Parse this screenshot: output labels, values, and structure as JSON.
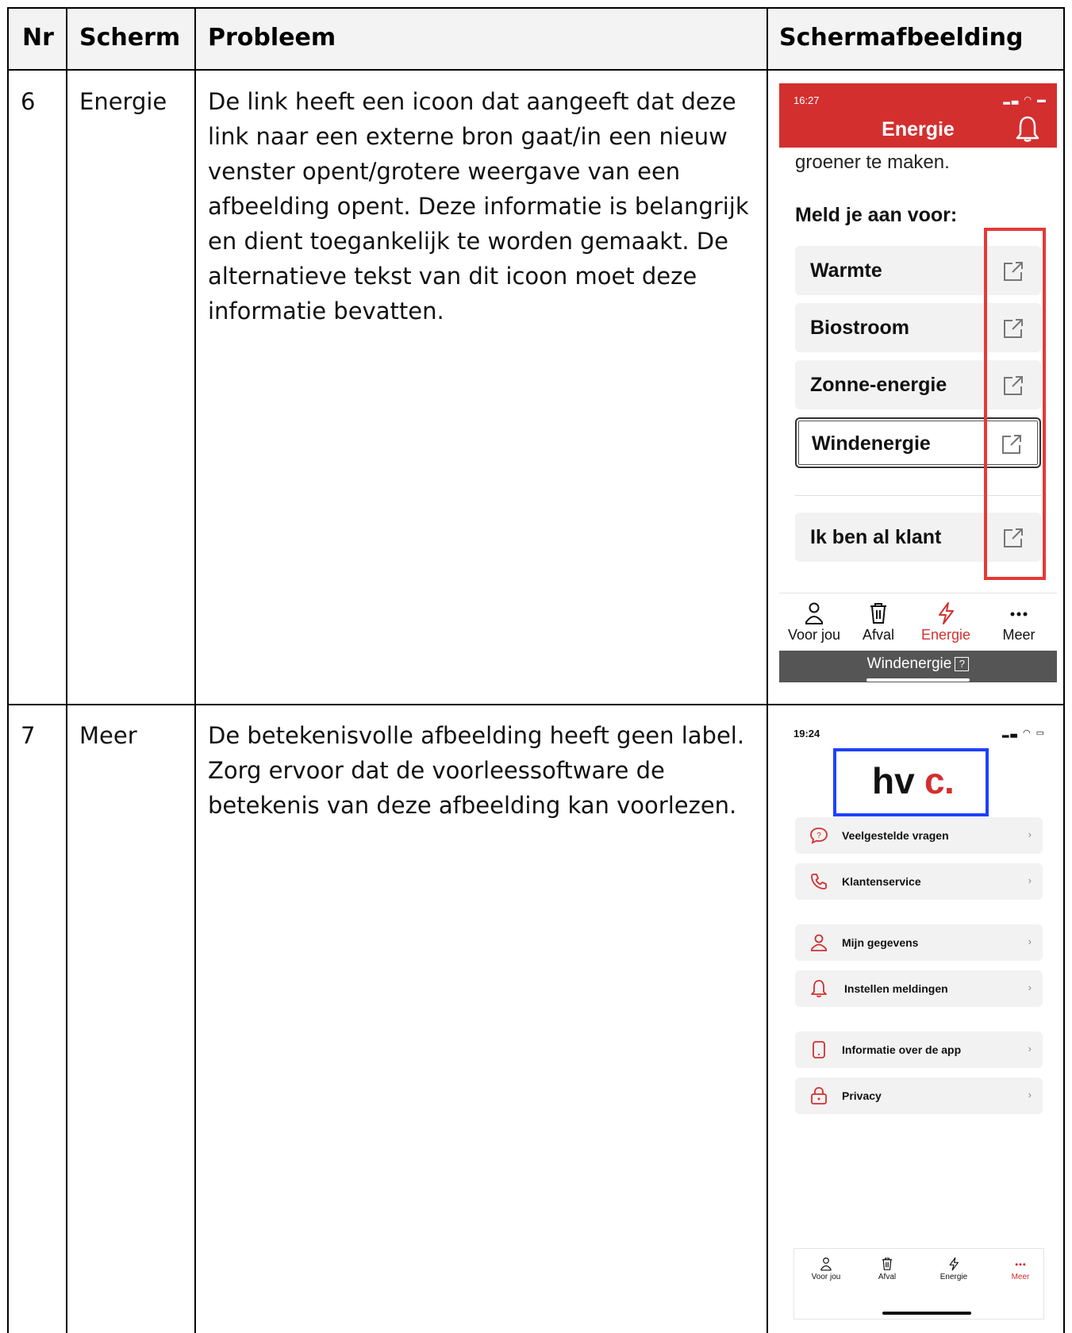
{
  "table": {
    "headers": {
      "nr": "Nr",
      "scherm": "Scherm",
      "probleem": "Probleem",
      "screenshot": "Schermafbeelding"
    },
    "rows": [
      {
        "nr": "6",
        "scherm": "Energie",
        "probleem": "De link heeft een icoon dat aangeeft dat deze link naar een externe bron gaat/in een nieuw venster opent/grotere weergave van een afbeelding opent. Deze informatie is belangrijk en dient toegankelijk te worden gemaakt. De alternatieve tekst van dit icoon moet deze informatie bevatten."
      },
      {
        "nr": "7",
        "scherm": "Meer",
        "probleem": "De betekenisvolle afbeelding heeft geen label. Zorg ervoor dat de voorleessoftware de betekenis van deze afbeelding kan voorlezen."
      }
    ]
  },
  "phone1": {
    "time": "16:27",
    "title": "Energie",
    "intro": "groener te maken.",
    "heading": "Meld je aan voor:",
    "items": [
      "Warmte",
      "Biostroom",
      "Zonne-energie",
      "Windenergie"
    ],
    "extra_item": "Ik ben al klant",
    "tooltip": "Windenergie",
    "tooltip_badge": "?",
    "accent_color": "#d32f2f",
    "highlight_color": "#e53935"
  },
  "tabs": [
    "Voor jou",
    "Afval",
    "Energie",
    "Meer"
  ],
  "phone2": {
    "time": "19:24",
    "logo_text": "hvc.",
    "highlight_color": "#1e40ff",
    "menu": [
      {
        "label": "Veelgestelde vragen",
        "icon": "question-bubble-icon"
      },
      {
        "label": "Klantenservice",
        "icon": "phone-icon"
      },
      {
        "label": "Mijn gegevens",
        "icon": "person-icon"
      },
      {
        "label": "Instellen meldingen",
        "icon": "bell-icon"
      },
      {
        "label": "Informatie over de app",
        "icon": "mobile-icon"
      },
      {
        "label": "Privacy",
        "icon": "lock-icon"
      }
    ]
  }
}
